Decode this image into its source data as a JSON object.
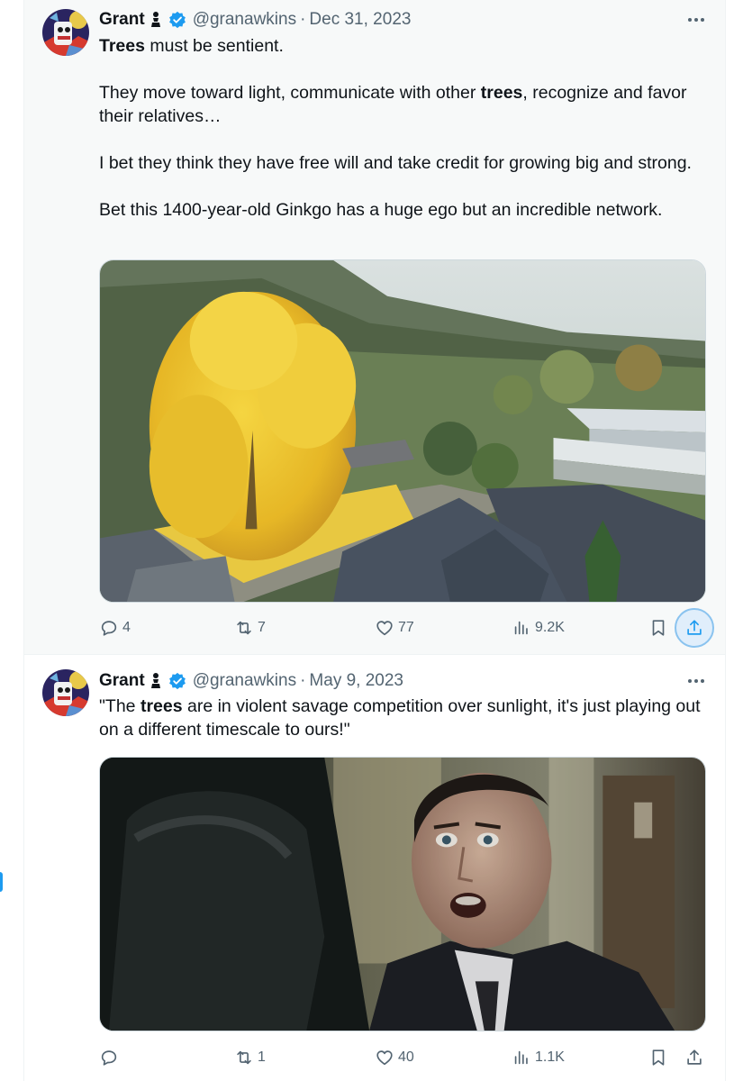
{
  "tweets": [
    {
      "author": {
        "name": "Grant",
        "handle": "@granawkins",
        "date": "Dec 31, 2023",
        "badges": [
          "pawn-icon",
          "verified-badge-icon"
        ]
      },
      "text": {
        "p1_bold": "Trees",
        "p1_rest": " must be sentient.",
        "p2_a": "They move toward light, communicate with other ",
        "p2_bold": "trees",
        "p2_b": ", recognize and favor their relatives…",
        "p3": "I bet they think they have free will and take credit for growing big and strong.",
        "p4": "Bet this 1400-year-old Ginkgo has a huge ego but an incredible network."
      },
      "media": {
        "kind": "photo",
        "subject": "golden ginkgo tree beside temple roofs in a hillside valley"
      },
      "actions": {
        "replies": "4",
        "reposts": "7",
        "likes": "77",
        "views": "9.2K",
        "share_highlighted": true
      }
    },
    {
      "author": {
        "name": "Grant",
        "handle": "@granawkins",
        "date": "May 9, 2023",
        "badges": [
          "pawn-icon",
          "verified-badge-icon"
        ]
      },
      "text": {
        "q_a": "\"The ",
        "q_bold": "trees",
        "q_b": " are in violent savage competition over sunlight, it's just playing out on a different timescale to ours!\""
      },
      "media": {
        "kind": "photo",
        "subject": "man in suit with wide eyes and open mouth, facing a blurred figure"
      },
      "actions": {
        "replies": "",
        "reposts": "1",
        "likes": "40",
        "views": "1.1K",
        "share_highlighted": false
      }
    }
  ],
  "colors": {
    "text": "#0f1419",
    "secondary": "#536471",
    "accent": "#1d9bf0",
    "border": "#cfd9de",
    "tweet_bg_hover": "#f7f9f9"
  },
  "sep": "·"
}
